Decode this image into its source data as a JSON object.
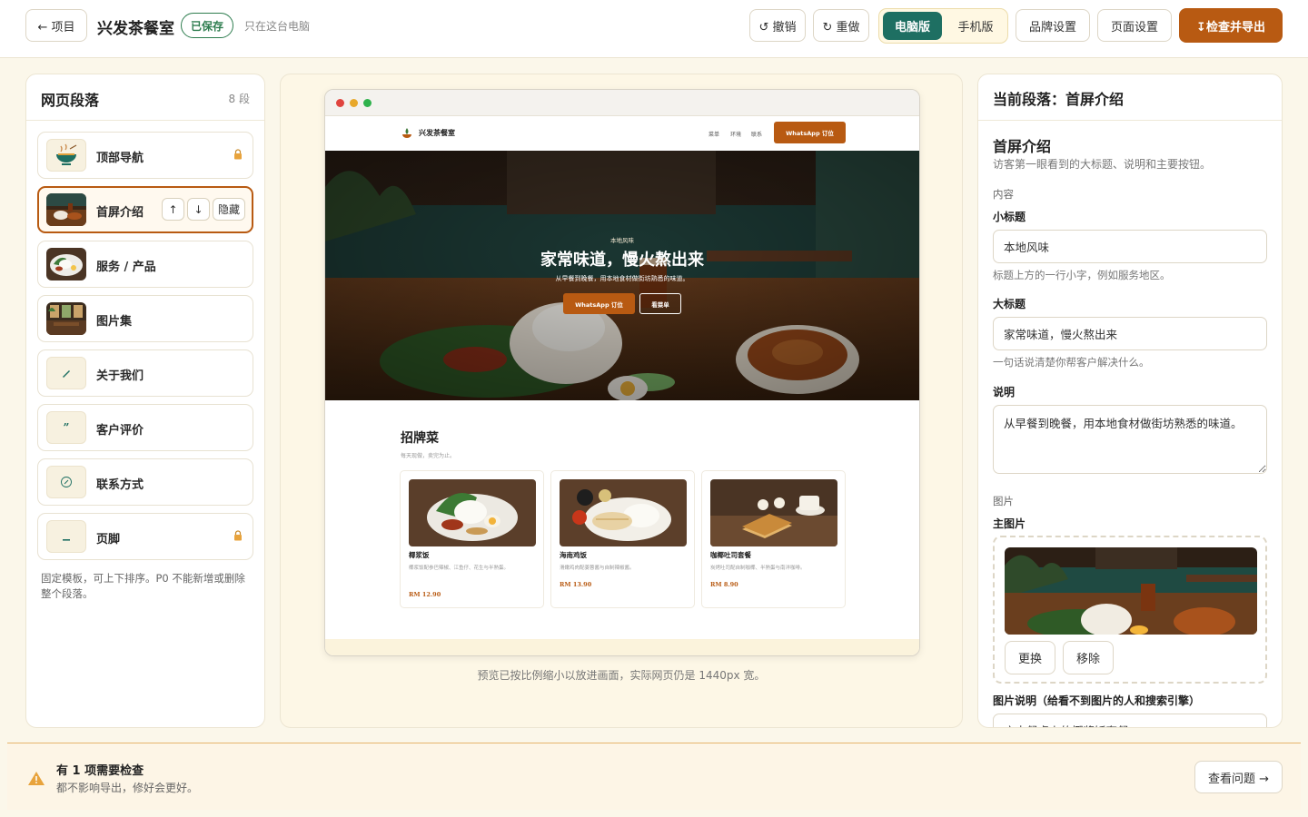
{
  "topbar": {
    "back_label": "← 项目",
    "site_name": "兴发茶餐室",
    "saved_badge": "已保存",
    "save_note": "只在这台电脑",
    "undo_label": "↺ 撤销",
    "redo_label": "↻ 重做",
    "device_desktop": "电脑版",
    "device_mobile": "手机版",
    "device_active": "电脑版",
    "brand_settings": "品牌设置",
    "page_settings": "页面设置",
    "export_label": "↧检查并导出"
  },
  "sections_panel": {
    "title": "网页段落",
    "count": "8 段",
    "items": [
      {
        "label": "顶部导航",
        "icon": "bowl-icon",
        "locked": true
      },
      {
        "label": "首屏介绍",
        "icon": "hero-thumbnail",
        "active": true
      },
      {
        "label": "服务 / 产品",
        "icon": "dish-thumbnail"
      },
      {
        "label": "图片集",
        "icon": "gallery-thumbnail"
      },
      {
        "label": "关于我们",
        "icon": "pen-icon"
      },
      {
        "label": "客户评价",
        "icon": "quote-icon"
      },
      {
        "label": "联系方式",
        "icon": "phone-icon"
      },
      {
        "label": "页脚",
        "icon": "underscore-icon",
        "locked": true
      }
    ],
    "move_up": "↑",
    "move_down": "↓",
    "hide_label": "隐藏",
    "note": "固定模板，可上下排序。P0 不能新增或删除整个段落。"
  },
  "preview": {
    "site_nav": {
      "name": "兴发茶餐室",
      "links": [
        "菜单",
        "环境",
        "联系"
      ],
      "cta": "WhatsApp 订位"
    },
    "hero": {
      "eyebrow": "本地风味",
      "title": "家常味道，慢火熬出来",
      "description": "从早餐到晚餐，用本地食材做街坊熟悉的味道。",
      "primary_button": "WhatsApp 订位",
      "secondary_button": "看菜单"
    },
    "signature": {
      "title": "招牌菜",
      "subtitle": "每天现做，卖完为止。",
      "dishes": [
        {
          "name": "椰浆饭",
          "description": "椰浆饭配参巴辣椒、江鱼仔、花生与半熟蛋。",
          "price": "RM 12.90"
        },
        {
          "name": "海南鸡饭",
          "description": "滑嫩鸡肉配姜蓉酱与自制辣椒酱。",
          "price": "RM 13.90"
        },
        {
          "name": "咖椰吐司套餐",
          "description": "炭烤吐司配自制咖椰、半熟蛋与南洋咖啡。",
          "price": "RM 8.90"
        }
      ]
    },
    "note": "预览已按比例缩小以放进画面，实际网页仍是 1440px 宽。"
  },
  "editor": {
    "title": "当前段落：首屏介绍",
    "section_heading": "首屏介绍",
    "section_desc": "访客第一眼看到的大标题、说明和主要按钮。",
    "content_group": "内容",
    "subtitle_label": "小标题",
    "subtitle_value": "本地风味",
    "subtitle_help": "标题上方的一行小字，例如服务地区。",
    "title_label": "大标题",
    "title_value": "家常味道，慢火熬出来",
    "title_help": "一句话说清楚你帮客户解决什么。",
    "desc_label": "说明",
    "desc_value": "从早餐到晚餐，用本地食材做街坊熟悉的味道。",
    "image_group": "图片",
    "main_image_label": "主图片",
    "replace_label": "更换",
    "remove_label": "移除",
    "alt_label": "图片说明（给看不到图片的人和搜索引擎）",
    "alt_value": "店内餐桌上的椰浆饭套餐"
  },
  "bottom": {
    "warning_title": "有 1 项需要检查",
    "warning_sub": "都不影响导出，修好会更好。",
    "view_issues": "查看问题 →"
  },
  "colors": {
    "accent": "#b85a12",
    "toggle_active": "#1e6f62",
    "saved_green": "#2e7d4f",
    "background": "#fbf7ea"
  }
}
